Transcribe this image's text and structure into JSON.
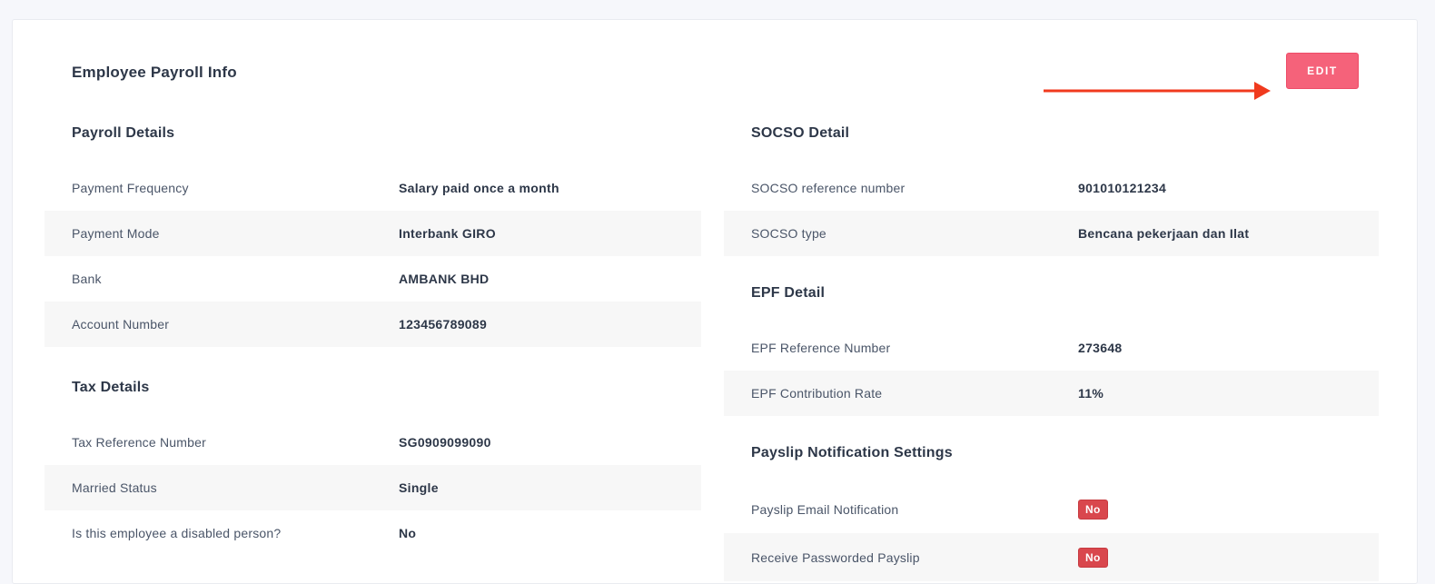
{
  "page": {
    "title": "Employee Payroll Info",
    "edit_label": "EDIT",
    "accent_color": "#f5627a",
    "arrow_color": "#f03a1e"
  },
  "payroll": {
    "title": "Payroll Details",
    "rows": [
      {
        "label": "Payment Frequency",
        "value": "Salary paid once a month"
      },
      {
        "label": "Payment Mode",
        "value": "Interbank GIRO"
      },
      {
        "label": "Bank",
        "value": "AMBANK BHD"
      },
      {
        "label": "Account Number",
        "value": "123456789089"
      }
    ]
  },
  "tax": {
    "title": "Tax Details",
    "rows": [
      {
        "label": "Tax Reference Number",
        "value": "SG0909099090"
      },
      {
        "label": "Married Status",
        "value": "Single"
      },
      {
        "label": "Is this employee a disabled person?",
        "value": "No"
      }
    ]
  },
  "socso": {
    "title": "SOCSO Detail",
    "rows": [
      {
        "label": "SOCSO reference number",
        "value": "901010121234"
      },
      {
        "label": "SOCSO type",
        "value": "Bencana pekerjaan dan Ilat"
      }
    ]
  },
  "epf": {
    "title": "EPF Detail",
    "rows": [
      {
        "label": "EPF Reference Number",
        "value": "273648"
      },
      {
        "label": "EPF Contribution Rate",
        "value": "11%"
      }
    ]
  },
  "payslip": {
    "title": "Payslip Notification Settings",
    "rows": [
      {
        "label": "Payslip Email Notification",
        "value": "No"
      },
      {
        "label": "Receive Passworded Payslip",
        "value": "No"
      }
    ]
  }
}
